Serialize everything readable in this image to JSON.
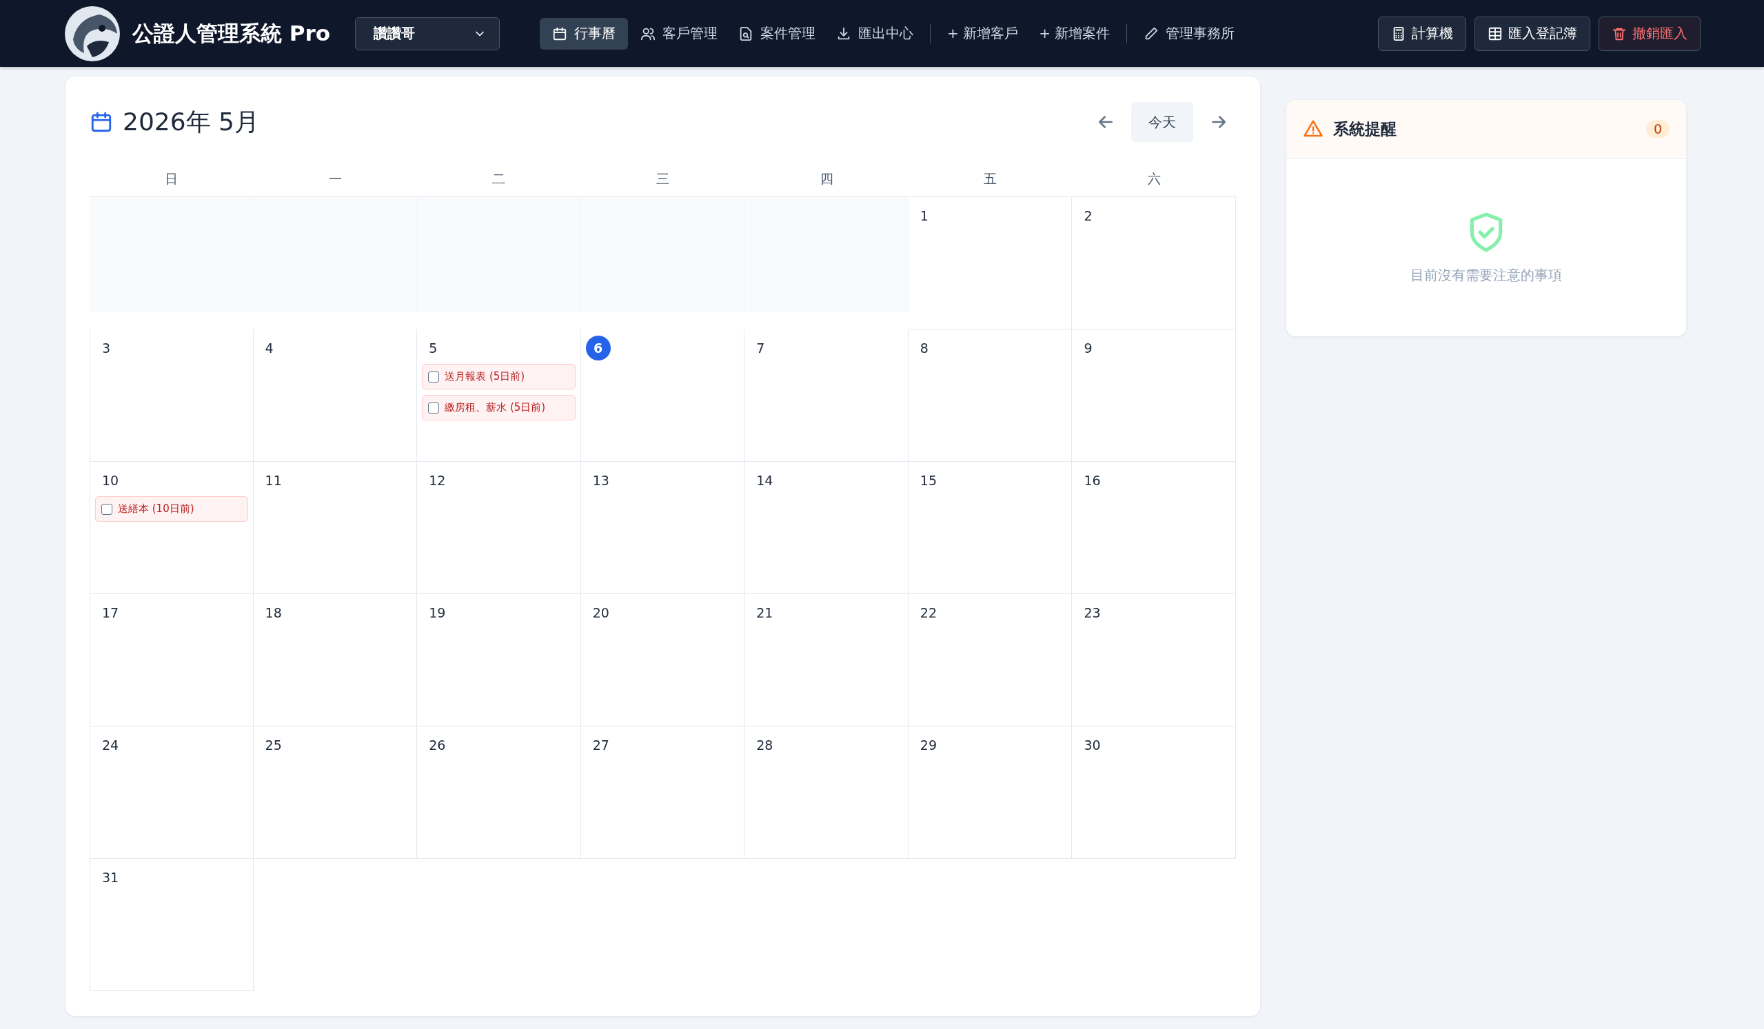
{
  "app": {
    "title": "公證人管理系統 Pro",
    "office_select": {
      "value": "讚讚哥"
    }
  },
  "nav": [
    {
      "kind": "calendar",
      "label": "行事曆",
      "selected": true
    },
    {
      "kind": "users",
      "label": "客戶管理",
      "selected": false
    },
    {
      "kind": "file",
      "label": "案件管理",
      "selected": false
    },
    {
      "kind": "download",
      "label": "匯出中心",
      "selected": false
    },
    {
      "kind": "divider"
    },
    {
      "kind": "text",
      "label": "+ 新增客戶",
      "selected": false
    },
    {
      "kind": "text",
      "label": "+ 新增案件",
      "selected": false
    },
    {
      "kind": "divider"
    },
    {
      "kind": "pencil",
      "label": "管理事務所",
      "selected": false
    }
  ],
  "actions": [
    {
      "kind": "calculator",
      "label": "計算機",
      "danger": false
    },
    {
      "kind": "table",
      "label": "匯入登記簿",
      "danger": false
    },
    {
      "kind": "trash",
      "label": "撤銷匯入",
      "danger": true
    }
  ],
  "calendar": {
    "title": "2026年 5月",
    "today_button": "今天",
    "weekdays": [
      "日",
      "一",
      "二",
      "三",
      "四",
      "五",
      "六"
    ],
    "weeks": [
      [
        {
          "kind": "blank"
        },
        {
          "kind": "blank"
        },
        {
          "kind": "blank"
        },
        {
          "kind": "blank"
        },
        {
          "kind": "blank"
        },
        {
          "kind": "day",
          "day": "1",
          "today": false
        },
        {
          "kind": "day",
          "day": "2",
          "today": false
        }
      ],
      [
        {
          "kind": "day",
          "day": "3",
          "today": false
        },
        {
          "kind": "day",
          "day": "4",
          "today": false
        },
        {
          "kind": "day",
          "day": "5",
          "today": false,
          "events": [
            {
              "text": "送月報表 (5日前)",
              "checked": false
            },
            {
              "text": "繳房租、薪水 (5日前)",
              "checked": false
            }
          ]
        },
        {
          "kind": "day",
          "day": "6",
          "today": true
        },
        {
          "kind": "day",
          "day": "7",
          "today": false
        },
        {
          "kind": "day",
          "day": "8",
          "today": false
        },
        {
          "kind": "day",
          "day": "9",
          "today": false
        }
      ],
      [
        {
          "kind": "day",
          "day": "10",
          "today": false,
          "events": [
            {
              "text": "送繕本 (10日前)",
              "checked": false
            }
          ]
        },
        {
          "kind": "day",
          "day": "11",
          "today": false
        },
        {
          "kind": "day",
          "day": "12",
          "today": false
        },
        {
          "kind": "day",
          "day": "13",
          "today": false
        },
        {
          "kind": "day",
          "day": "14",
          "today": false
        },
        {
          "kind": "day",
          "day": "15",
          "today": false
        },
        {
          "kind": "day",
          "day": "16",
          "today": false
        }
      ],
      [
        {
          "kind": "day",
          "day": "17",
          "today": false
        },
        {
          "kind": "day",
          "day": "18",
          "today": false
        },
        {
          "kind": "day",
          "day": "19",
          "today": false
        },
        {
          "kind": "day",
          "day": "20",
          "today": false
        },
        {
          "kind": "day",
          "day": "21",
          "today": false
        },
        {
          "kind": "day",
          "day": "22",
          "today": false
        },
        {
          "kind": "day",
          "day": "23",
          "today": false
        }
      ],
      [
        {
          "kind": "day",
          "day": "24",
          "today": false
        },
        {
          "kind": "day",
          "day": "25",
          "today": false
        },
        {
          "kind": "day",
          "day": "26",
          "today": false
        },
        {
          "kind": "day",
          "day": "27",
          "today": false
        },
        {
          "kind": "day",
          "day": "28",
          "today": false
        },
        {
          "kind": "day",
          "day": "29",
          "today": false
        },
        {
          "kind": "day",
          "day": "30",
          "today": false
        }
      ],
      [
        {
          "kind": "day",
          "day": "31",
          "today": false
        }
      ]
    ]
  },
  "alerts": {
    "title": "系統提醒",
    "count": "0",
    "empty_message": "目前沒有需要注意的事項"
  }
}
